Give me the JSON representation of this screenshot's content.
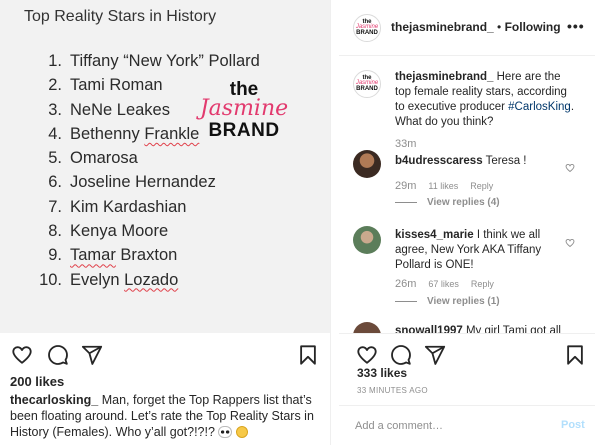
{
  "post_image": {
    "title": "Top Reality Stars in History",
    "ranking": [
      {
        "num": "1.",
        "name": "Tiffany “New York” Pollard"
      },
      {
        "num": "2.",
        "name": "Tami Roman"
      },
      {
        "num": "3.",
        "name": "NeNe Leakes"
      },
      {
        "num": "4.",
        "name": "Bethenny Frankle"
      },
      {
        "num": "5.",
        "name": "Omarosa"
      },
      {
        "num": "6.",
        "name": "Joseline Hernandez"
      },
      {
        "num": "7.",
        "name": "Kim Kardashian"
      },
      {
        "num": "8.",
        "name": "Kenya Moore"
      },
      {
        "num": "9.",
        "name": "Tamar Braxton"
      },
      {
        "num": "10.",
        "name": "Evelyn Lozado"
      }
    ],
    "watermark": {
      "the": "the",
      "jasmine": "Jasmine",
      "brand": "BRAND"
    }
  },
  "left_post": {
    "likes": "200 likes",
    "caption_user": "thecarlosking_",
    "caption_text": " Man, forget the Top Rappers list that’s been floating around. Let’s rate the Top Reality Stars in History (Females). Who y’all got?!?!?",
    "emojis": [
      "eyes",
      "thinking-face"
    ]
  },
  "header": {
    "avatar_text": [
      "the",
      "Jasmine",
      "BRAND"
    ],
    "username": "thejasminebrand_",
    "separator": " • ",
    "follow_state": "Following",
    "more": "•••"
  },
  "caption_comment": {
    "user": "thejasminebrand_",
    "text_before": " Here are the top female reality stars, according to executive producer ",
    "tag": "#CarlosKing",
    "text_after": ". What do you think?",
    "time": "33m"
  },
  "comments": [
    {
      "user": "b4udresscaress",
      "text": " Teresa !",
      "time": "29m",
      "likes": "11 likes",
      "reply": "Reply",
      "view_replies": "View replies (4)"
    },
    {
      "user": "kisses4_marie",
      "text": " I think we all agree, New York AKA Tiffany Pollard is ONE!",
      "time": "26m",
      "likes": "67 likes",
      "reply": "Reply",
      "view_replies": "View replies (1)"
    },
    {
      "user": "snowall1997",
      "text": " My girl Tami got all"
    }
  ],
  "right_post": {
    "likes": "333 likes",
    "timestamp": "33 MINUTES AGO",
    "comment_placeholder": "Add a comment…",
    "post_label": "Post"
  },
  "colors": {
    "brand_pink": "#e23a6e",
    "link_blue": "#00376b",
    "post_button_disabled": "#b2dffc",
    "meta_gray": "#8e8e8e"
  }
}
